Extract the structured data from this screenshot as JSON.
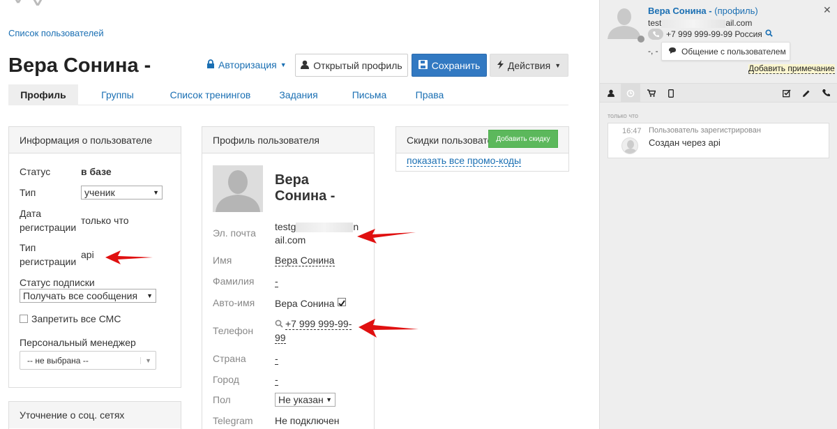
{
  "breadcrumb": "Список пользователей",
  "page_title": "Вера Сонина -",
  "toolbar": {
    "auth_label": "Авторизация",
    "open_profile_label": "Открытый профиль",
    "save_label": "Сохранить",
    "actions_label": "Действия"
  },
  "tabs": [
    "Профиль",
    "Группы",
    "Список тренингов",
    "Задания",
    "Письма",
    "Права"
  ],
  "info_panel": {
    "title": "Информация о пользователе",
    "status_label": "Статус",
    "status_value": "в базе",
    "type_label": "Тип",
    "type_value": "ученик",
    "reg_date_label_1": "Дата",
    "reg_date_label_2": "регистрации",
    "reg_date_value": "только что",
    "reg_type_label_1": "Тип",
    "reg_type_label_2": "регистрации",
    "reg_type_value": "api",
    "subscription_label": "Статус подписки",
    "subscription_value": "Получать все сообщения",
    "sms_label": "Запретить все СМС",
    "manager_label": "Персональный менеджер",
    "manager_value": "-- не выбрана --"
  },
  "social_panel": {
    "title": "Уточнение о соц. сетях"
  },
  "profile_panel": {
    "title": "Профиль пользователя",
    "name_line1": "Вера",
    "name_line2": "Сонина -",
    "email_label": "Эл. почта",
    "email_value_1a": "testg",
    "email_value_1b": "n",
    "email_value_2": "ail.com",
    "first_name_label": "Имя",
    "first_name_value": "Вера Сонина",
    "last_name_label": "Фамилия",
    "last_name_value": "-",
    "auto_name_label": "Авто-имя",
    "auto_name_value": "Вера Сонина",
    "phone_label": "Телефон",
    "phone_value_1": "+7 999 999-99-",
    "phone_value_2": "99",
    "country_label": "Страна",
    "country_value": "-",
    "city_label": "Город",
    "city_value": "-",
    "gender_label": "Пол",
    "gender_value": "Не указан",
    "telegram_label": "Telegram",
    "telegram_value": "Не подключен"
  },
  "discount_panel": {
    "title": "Скидки пользовате",
    "add_button": "Добавить скидку",
    "promo_link": "показать все промо-коды"
  },
  "sidebar": {
    "user_name": "Вера Сонина -",
    "profile_link": "(профиль)",
    "email_start": "test",
    "email_end": "ail.com",
    "phone": "+7 999 999-99-99 Россия",
    "misc": "-, -",
    "chat_button": "Общение с пользователем",
    "add_note": "Добавить примечание",
    "time_header": "только что",
    "event_time": "16:47",
    "event_title": "Пользователь зарегистрирован",
    "event_text": "Создан через api"
  },
  "colors": {
    "accent": "#1a6fb3",
    "save": "#3279c2",
    "discount": "#5cb85c",
    "arrow": "#e01010"
  }
}
